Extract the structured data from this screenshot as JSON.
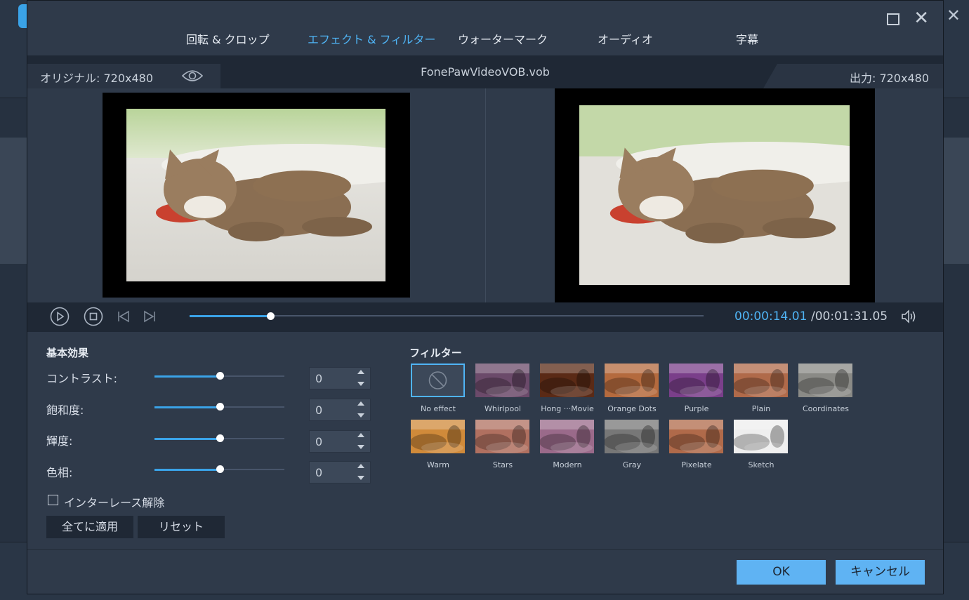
{
  "tabs": [
    {
      "label": "回転 & クロップ"
    },
    {
      "label": "エフェクト & フィルター"
    },
    {
      "label": "ウォーターマーク"
    },
    {
      "label": "オーディオ"
    },
    {
      "label": "字幕"
    }
  ],
  "active_tab": "エフェクト & フィルター",
  "preview": {
    "original_label": "オリジナル: 720x480",
    "file_name": "FonePawVideoVOB.vob",
    "output_label": "出力: 720x480"
  },
  "playback": {
    "current_time": "00:00:14.01",
    "total_time": "/00:01:31.05",
    "progress": 0.157
  },
  "basic_effects": {
    "title": "基本効果",
    "sliders": [
      {
        "label": "コントラスト:",
        "value": "0",
        "position": 0.5
      },
      {
        "label": "飽和度:",
        "value": "0",
        "position": 0.5
      },
      {
        "label": "輝度:",
        "value": "0",
        "position": 0.5
      },
      {
        "label": "色相:",
        "value": "0",
        "position": 0.5
      }
    ],
    "deinterlace_label": "インターレース解除",
    "deinterlace_checked": false,
    "apply_all_label": "全てに適用",
    "reset_label": "リセット"
  },
  "filters": {
    "title": "フィルター",
    "items": [
      {
        "label": "No effect",
        "selected": true
      },
      {
        "label": "Whirlpool"
      },
      {
        "label": "Hong ···Movie"
      },
      {
        "label": "Orange Dots"
      },
      {
        "label": "Purple"
      },
      {
        "label": "Plain"
      },
      {
        "label": "Coordinates"
      },
      {
        "label": "Warm"
      },
      {
        "label": "Stars"
      },
      {
        "label": "Modern"
      },
      {
        "label": "Gray"
      },
      {
        "label": "Pixelate"
      },
      {
        "label": "Sketch"
      }
    ]
  },
  "footer": {
    "ok_label": "OK",
    "cancel_label": "キャンセル"
  },
  "colors": {
    "accent": "#4fb4f5",
    "button_blue": "#5fb3f3",
    "dialog_bg": "#2f3a4a"
  }
}
